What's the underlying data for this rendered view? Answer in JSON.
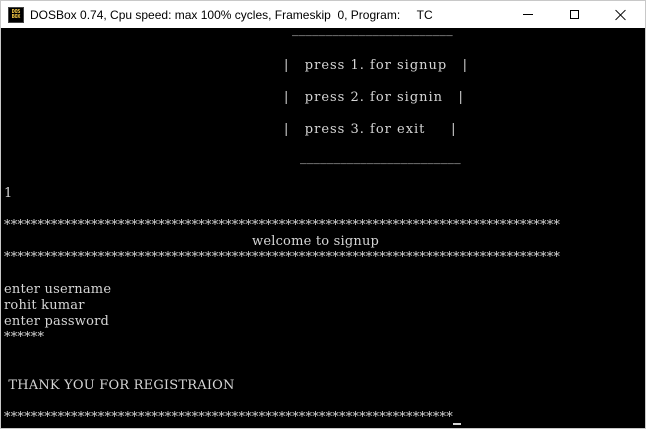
{
  "window": {
    "title": "DOSBox 0.74, Cpu speed: max 100% cycles, Frameskip  0, Program:     TC",
    "icon_top": "DOS",
    "icon_bottom": "BOX",
    "buttons": [
      "minimize-icon",
      "maximize-icon",
      "close-icon"
    ]
  },
  "menu": {
    "top_rule": "________________________",
    "option1": "|   press 1. for signup   |",
    "option2": "|   press 2. for signin   |",
    "option3": "|   press 3. for exit     |",
    "bottom_rule": "________________________"
  },
  "console": {
    "choice": "1",
    "stars_top": "***********************************************************************************",
    "heading": "welcome to signup",
    "stars_mid": "***********************************************************************************",
    "prompt_username": "enter username",
    "username_value": "rohit kumar",
    "prompt_password": "enter password",
    "password_mask": "******",
    "thanks": " THANK YOU FOR REGISTRAION",
    "stars_bottom": "*******************************************************************"
  },
  "colors": {
    "background": "#000000",
    "text": "#d6d6d6",
    "titlebar": "#ffffff"
  }
}
